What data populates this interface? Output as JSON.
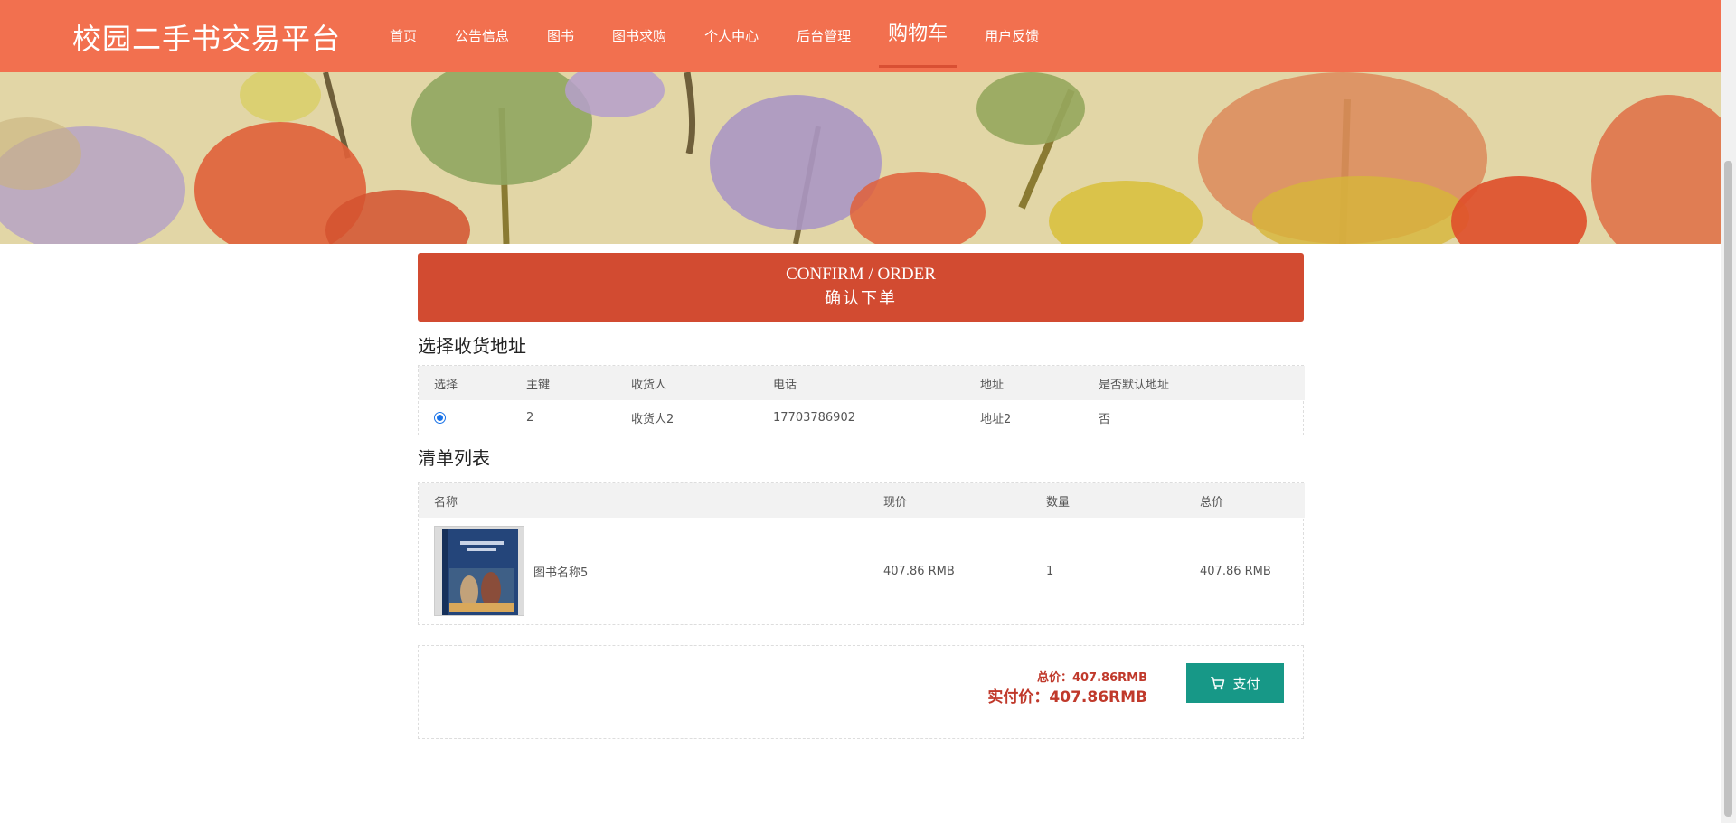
{
  "brand": "校园二手书交易平台",
  "nav": [
    {
      "label": "首页"
    },
    {
      "label": "公告信息"
    },
    {
      "label": "图书"
    },
    {
      "label": "图书求购"
    },
    {
      "label": "个人中心"
    },
    {
      "label": "后台管理"
    },
    {
      "label": "购物车",
      "active": true
    },
    {
      "label": "用户反馈"
    }
  ],
  "confirm": {
    "en": "CONFIRM / ORDER",
    "cn": "确认下单"
  },
  "address": {
    "title": "选择收货地址",
    "headers": [
      "选择",
      "主键",
      "收货人",
      "电话",
      "地址",
      "是否默认地址"
    ],
    "rows": [
      {
        "id": "2",
        "name": "收货人2",
        "phone": "17703786902",
        "addr": "地址2",
        "default": "否"
      }
    ]
  },
  "list": {
    "title": "清单列表",
    "headers": [
      "名称",
      "现价",
      "数量",
      "总价"
    ],
    "items": [
      {
        "name": "图书名称5",
        "price": "407.86 RMB",
        "qty": "1",
        "total": "407.86 RMB"
      }
    ]
  },
  "summary": {
    "total_old": "总价：407.86RMB",
    "total_real": "实付价：407.86RMB",
    "pay_label": "支付"
  },
  "colors": {
    "nav": "#f2704f",
    "confirm": "#d24b31",
    "pay": "#179887",
    "price": "#c0392b"
  }
}
